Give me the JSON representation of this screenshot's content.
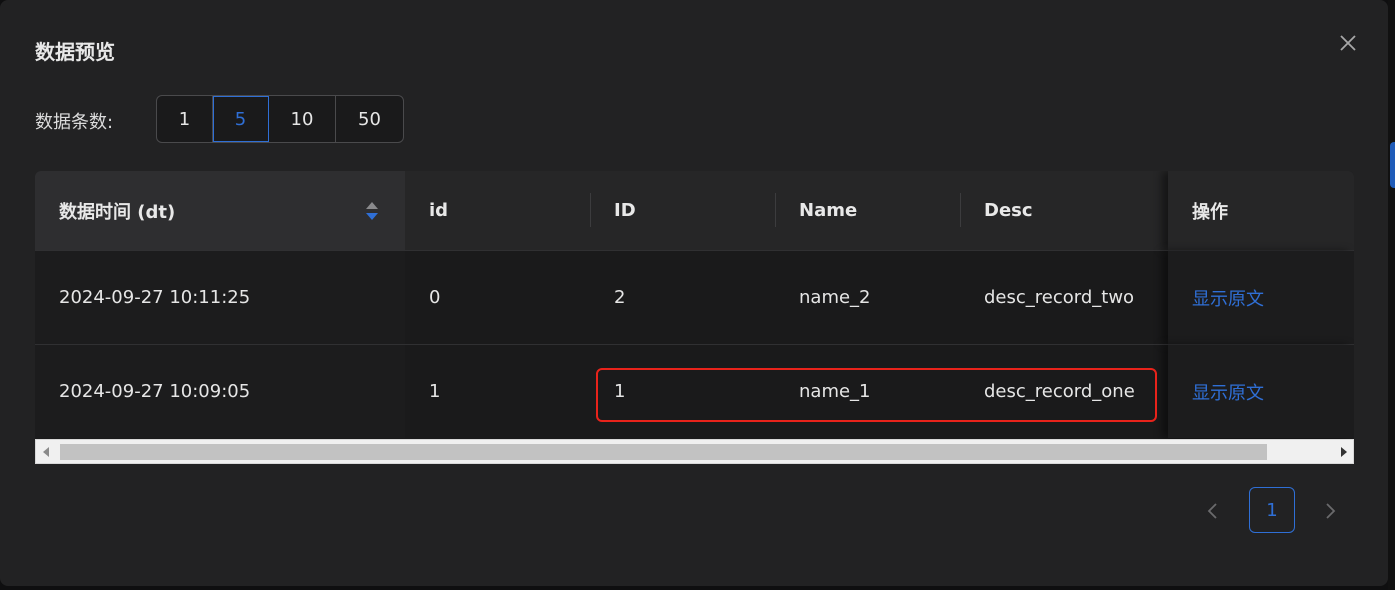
{
  "dialog": {
    "title": "数据预览"
  },
  "row_count": {
    "label": "数据条数:",
    "options": [
      "1",
      "5",
      "10",
      "50"
    ],
    "selected": "5"
  },
  "table": {
    "columns": [
      "数据时间 (dt)",
      "id",
      "ID",
      "Name",
      "Desc",
      "操作"
    ],
    "rows": [
      {
        "dt": "2024-09-27 10:11:25",
        "id": "0",
        "ID": "2",
        "name": "name_2",
        "desc": "desc_record_two",
        "action": "显示原文"
      },
      {
        "dt": "2024-09-27 10:09:05",
        "id": "1",
        "ID": "1",
        "name": "name_1",
        "desc": "desc_record_one",
        "action": "显示原文"
      }
    ]
  },
  "pagination": {
    "current": "1"
  },
  "colors": {
    "accent": "#2f6fd6",
    "highlight": "#e8231b"
  }
}
